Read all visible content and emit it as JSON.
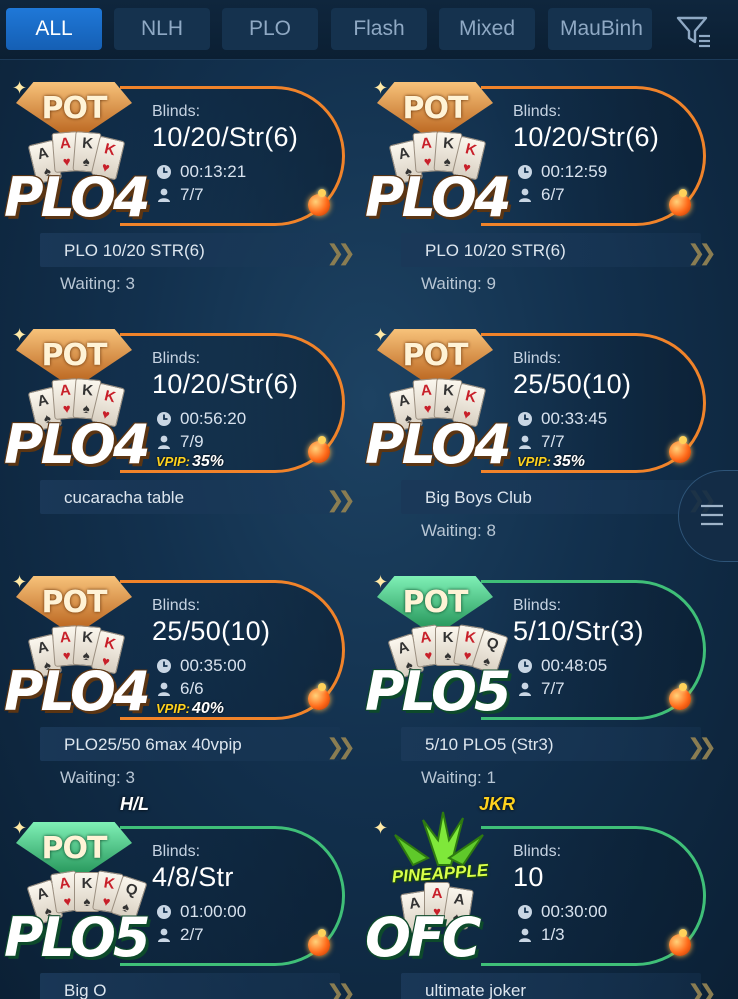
{
  "tabs": [
    {
      "label": "ALL",
      "active": true
    },
    {
      "label": "NLH",
      "active": false
    },
    {
      "label": "PLO",
      "active": false
    },
    {
      "label": "Flash",
      "active": false
    },
    {
      "label": "Mixed",
      "active": false
    },
    {
      "label": "MauBinh",
      "active": false
    }
  ],
  "icons": {
    "filter": "filter-icon",
    "side_menu": "menu-lines-icon",
    "clock": "clock-icon",
    "player": "person-icon"
  },
  "colors": {
    "accent_blue": "#1f78d8",
    "ring_orange": "#f0832a",
    "ring_green": "#3fbf78",
    "vpip_yellow": "#ffd21e"
  },
  "blinds_label": "Blinds:",
  "vpip_label": "VPIP:",
  "tables": [
    {
      "pot_word": "POT",
      "game": "PLO4",
      "theme": "orange",
      "cards": [
        "A",
        "A",
        "K",
        "K"
      ],
      "blinds": "10/20/Str(6)",
      "time": "00:13:21",
      "players": "7/7",
      "vpip": "",
      "name": "PLO 10/20 STR(6)",
      "waiting": "Waiting: 3",
      "tag": ""
    },
    {
      "pot_word": "POT",
      "game": "PLO4",
      "theme": "orange",
      "cards": [
        "A",
        "A",
        "K",
        "K"
      ],
      "blinds": "10/20/Str(6)",
      "time": "00:12:59",
      "players": "6/7",
      "vpip": "",
      "name": "PLO 10/20 STR(6)",
      "waiting": "Waiting: 9",
      "tag": ""
    },
    {
      "pot_word": "POT",
      "game": "PLO4",
      "theme": "orange",
      "cards": [
        "A",
        "A",
        "K",
        "K"
      ],
      "blinds": "10/20/Str(6)",
      "time": "00:56:20",
      "players": "7/9",
      "vpip": "35%",
      "name": "cucaracha table",
      "waiting": "",
      "tag": ""
    },
    {
      "pot_word": "POT",
      "game": "PLO4",
      "theme": "orange",
      "cards": [
        "A",
        "A",
        "K",
        "K"
      ],
      "blinds": "25/50(10)",
      "time": "00:33:45",
      "players": "7/7",
      "vpip": "35%",
      "name": "Big Boys Club",
      "waiting": "Waiting: 8",
      "tag": ""
    },
    {
      "pot_word": "POT",
      "game": "PLO4",
      "theme": "orange",
      "cards": [
        "A",
        "A",
        "K",
        "K"
      ],
      "blinds": "25/50(10)",
      "time": "00:35:00",
      "players": "6/6",
      "vpip": "40%",
      "name": "PLO25/50 6max 40vpip",
      "waiting": "Waiting: 3",
      "tag": ""
    },
    {
      "pot_word": "POT",
      "game": "PLO5",
      "theme": "green",
      "cards": [
        "A",
        "A",
        "K",
        "K",
        "Q"
      ],
      "blinds": "5/10/Str(3)",
      "time": "00:48:05",
      "players": "7/7",
      "vpip": "",
      "name": "5/10 PLO5 (Str3)",
      "waiting": "Waiting: 1",
      "tag": ""
    },
    {
      "pot_word": "POT",
      "game": "PLO5",
      "theme": "green",
      "cards": [
        "A",
        "A",
        "K",
        "K",
        "Q"
      ],
      "blinds": "4/8/Str",
      "time": "01:00:00",
      "players": "2/7",
      "vpip": "",
      "name": "Big O",
      "waiting": "",
      "tag": "H/L"
    },
    {
      "pot_word": "PINEAPPLE",
      "game": "OFC",
      "theme": "green",
      "cards": [
        "A",
        "A",
        "A"
      ],
      "blinds": "10",
      "time": "00:30:00",
      "players": "1/3",
      "vpip": "",
      "name": "ultimate joker",
      "waiting": "",
      "tag": "JKR"
    }
  ]
}
